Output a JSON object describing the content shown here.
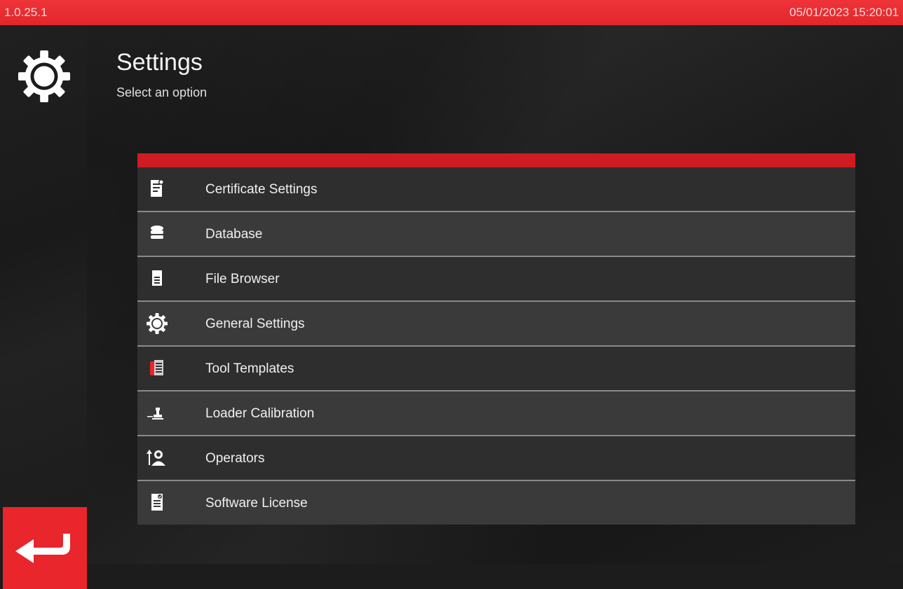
{
  "status_bar": {
    "version": "1.0.25.1",
    "datetime": "05/01/2023 15:20:01"
  },
  "header": {
    "title": "Settings",
    "subtitle": "Select an option"
  },
  "sidebar": {
    "icon": "gear-icon",
    "back_icon": "return-arrow-icon"
  },
  "menu": {
    "items": [
      {
        "label": "Certificate Settings",
        "icon": "certificate-icon"
      },
      {
        "label": "Database",
        "icon": "database-icon"
      },
      {
        "label": "File Browser",
        "icon": "file-icon"
      },
      {
        "label": "General Settings",
        "icon": "gear-icon"
      },
      {
        "label": "Tool Templates",
        "icon": "templates-icon"
      },
      {
        "label": "Loader Calibration",
        "icon": "loader-icon"
      },
      {
        "label": "Operators",
        "icon": "operator-icon"
      },
      {
        "label": "Software License",
        "icon": "license-icon"
      }
    ]
  },
  "colors": {
    "accent": "#e8262c",
    "menu_header": "#cf1c22"
  }
}
